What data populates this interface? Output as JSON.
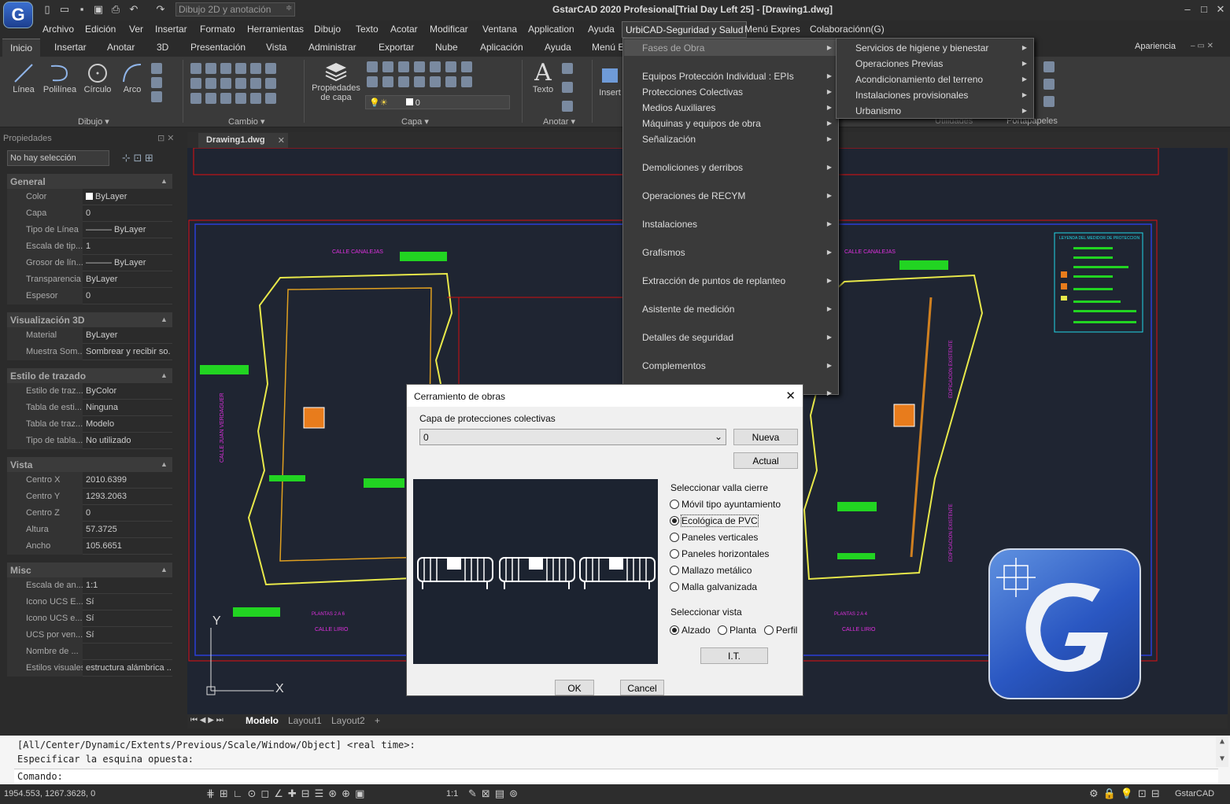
{
  "titlebar": {
    "logo_letter": "G",
    "workspace": "Dibujo 2D y anotación",
    "title": "GstarCAD 2020 Profesional[Trial Day Left 25] - [Drawing1.dwg]"
  },
  "menubar": {
    "items": [
      "Archivo",
      "Edición",
      "Ver",
      "Insertar",
      "Formato",
      "Herramientas",
      "Dibujo",
      "Texto",
      "Acotar",
      "Modificar",
      "Ventana",
      "Application",
      "Ayuda",
      "UrbiCAD-Seguridad y Salud",
      "Menú Expres",
      "Colaboraciónn(G)"
    ]
  },
  "ribbon_tabs": [
    "Inicio",
    "Insertar",
    "Anotar",
    "3D",
    "Presentación",
    "Vista",
    "Administrar",
    "Exportar",
    "Nube",
    "Aplicación",
    "Ayuda",
    "Menú E"
  ],
  "ribbon": {
    "tools": {
      "linea": "Línea",
      "polilinea": "Polilínea",
      "circulo": "Círculo",
      "arco": "Arco",
      "propiedades_capa": "Propiedades de capa",
      "texto": "Texto",
      "insertar": "Insert"
    },
    "groups": {
      "dibujo": "Dibujo",
      "cambio": "Cambio",
      "capa": "Capa",
      "anotar": "Anotar",
      "utilidades": "Utilidades",
      "portapapeles": "Portapapeles"
    },
    "layer_value": "0",
    "apariencia": "Apariencia"
  },
  "properties": {
    "title": "Propiedades",
    "selection": "No hay selección",
    "groups": [
      {
        "name": "General",
        "rows": [
          [
            "Color",
            "ByLayer"
          ],
          [
            "Capa",
            "0"
          ],
          [
            "Tipo de Línea",
            "——— ByLayer"
          ],
          [
            "Escala de tip...",
            "1"
          ],
          [
            "Grosor de lín...",
            "——— ByLayer"
          ],
          [
            "Transparencia",
            "ByLayer"
          ],
          [
            "Espesor",
            "0"
          ]
        ]
      },
      {
        "name": "Visualización 3D",
        "rows": [
          [
            "Material",
            "ByLayer"
          ],
          [
            "Muestra Som...",
            "Sombrear y recibir so..."
          ]
        ]
      },
      {
        "name": "Estilo de trazado",
        "rows": [
          [
            "Estilo de traz...",
            "ByColor"
          ],
          [
            "Tabla de esti...",
            "Ninguna"
          ],
          [
            "Tabla de traz...",
            "Modelo"
          ],
          [
            "Tipo de tabla...",
            "No utilizado"
          ]
        ]
      },
      {
        "name": "Vista",
        "rows": [
          [
            "Centro X",
            "2010.6399"
          ],
          [
            "Centro Y",
            "1293.2063"
          ],
          [
            "Centro Z",
            "0"
          ],
          [
            "Altura",
            "57.3725"
          ],
          [
            "Ancho",
            "105.6651"
          ]
        ]
      },
      {
        "name": "Misc",
        "rows": [
          [
            "Escala de an...",
            "1:1"
          ],
          [
            "Icono UCS E...",
            "Sí"
          ],
          [
            "Icono UCS e...",
            "Sí"
          ],
          [
            "UCS por ven...",
            "Sí"
          ],
          [
            "Nombre de ...",
            ""
          ],
          [
            "Estilos visuales",
            "estructura alámbrica ..."
          ]
        ]
      }
    ]
  },
  "drawing": {
    "tab": "Drawing1.dwg",
    "labels": {
      "calle1": "CALLE CANALEJAS",
      "calle2": "CALLE CANALEJAS",
      "calle_juan": "CALLE JUAN VERDAGUER",
      "plantas1": "PLANTAS 2 A 6",
      "plantas2": "PLANTAS 2 A 4",
      "calle_lirio1": "CALLE LIRIO",
      "calle_lirio2": "CALLE LIRIO",
      "edif1": "EDIFICACION EXISTENTE",
      "edif2": "EDIFICACION EXISTENTE",
      "legend_title": "LEYENDA DEL MEDIDOR DE PROTECCION"
    },
    "ucs": {
      "y": "Y",
      "x": "X"
    }
  },
  "layout_tabs": [
    "Modelo",
    "Layout1",
    "Layout2",
    "+"
  ],
  "submenu1": {
    "items": [
      "Fases de Obra",
      "Equipos Protección Individual : EPIs",
      "Protecciones Colectivas",
      "Medios Auxiliares",
      "Máquinas y equipos de obra",
      "Señalización",
      "Demoliciones y derribos",
      "Operaciones de RECYM",
      "Instalaciones",
      "Grafismos",
      "Extracción de puntos de replanteo",
      "Asistente de medición",
      "Detalles de seguridad",
      "Complementos"
    ]
  },
  "submenu2": {
    "items": [
      "Servicios de higiene y bienestar",
      "Operaciones Previas",
      "Acondicionamiento del terreno",
      "Instalaciones provisionales",
      "Urbanismo"
    ]
  },
  "dialog": {
    "title": "Cerramiento de obras",
    "group_capa": "Capa de protecciones colectivas",
    "layer": "0",
    "nueva": "Nueva",
    "actual": "Actual",
    "group_valla": "Seleccionar valla cierre",
    "vallas": [
      "Móvil tipo ayuntamiento",
      "Ecológica de PVC",
      "Paneles verticales",
      "Paneles horizontales",
      "Mallazo metálico",
      "Malla galvanizada"
    ],
    "valla_selected": 1,
    "group_vista": "Seleccionar vista",
    "vistas": [
      "Alzado",
      "Planta",
      "Perfil"
    ],
    "vista_selected": 0,
    "it": "I.T.",
    "ok": "OK",
    "cancel": "Cancel"
  },
  "command": {
    "line1": "[All/Center/Dynamic/Extents/Previous/Scale/Window/Object] <real time>:",
    "line2": "Especificar la esquina opuesta:",
    "prompt": "Comando:"
  },
  "status": {
    "coords": "1954.553, 1267.3628, 0",
    "scale": "1:1",
    "app": "GstarCAD"
  },
  "colors": {
    "accent": "#2a57c2",
    "canvas": "#1f2532",
    "menu": "#3a3a3a"
  }
}
